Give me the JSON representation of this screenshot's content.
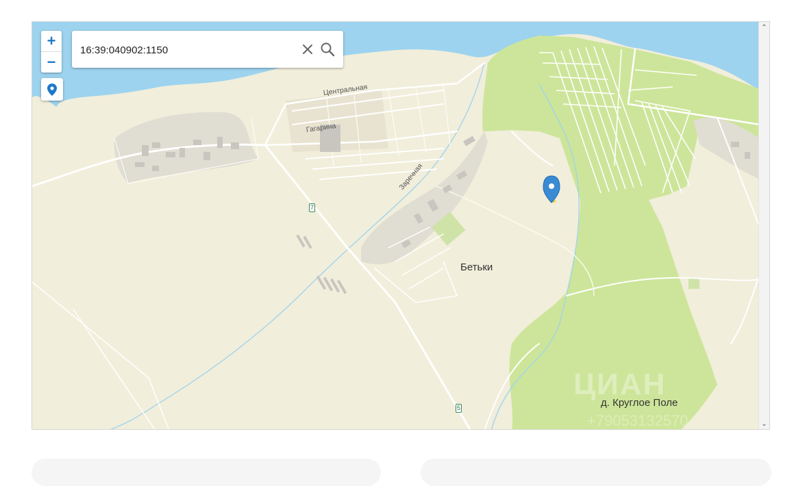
{
  "search": {
    "value": "16:39:040902:1150"
  },
  "controls": {
    "zoom_in": "+",
    "zoom_out": "−"
  },
  "scroll": {
    "up": "⌃",
    "down": "⌄"
  },
  "places": {
    "betki": "Бетьки",
    "krugloe_pole": "д. Круглое Поле"
  },
  "streets": {
    "central": "Центральная",
    "gagarina": "Гагарина",
    "zarechnaya": "Заречная"
  },
  "road_numbers": {
    "r7": "7",
    "r5": "5"
  },
  "watermark": {
    "brand": "ЦИАН",
    "phone": "+79053132570"
  },
  "colors": {
    "water": "#9dd3ee",
    "land": "#f1eedb",
    "forest": "#cde59a",
    "urban": "#e0ddd2",
    "accent": "#1f78c8",
    "marker": "#3b8bd4"
  },
  "icons": [
    "zoom-in-icon",
    "zoom-out-icon",
    "location-pin-icon",
    "close-icon",
    "search-icon",
    "map-marker-icon"
  ]
}
